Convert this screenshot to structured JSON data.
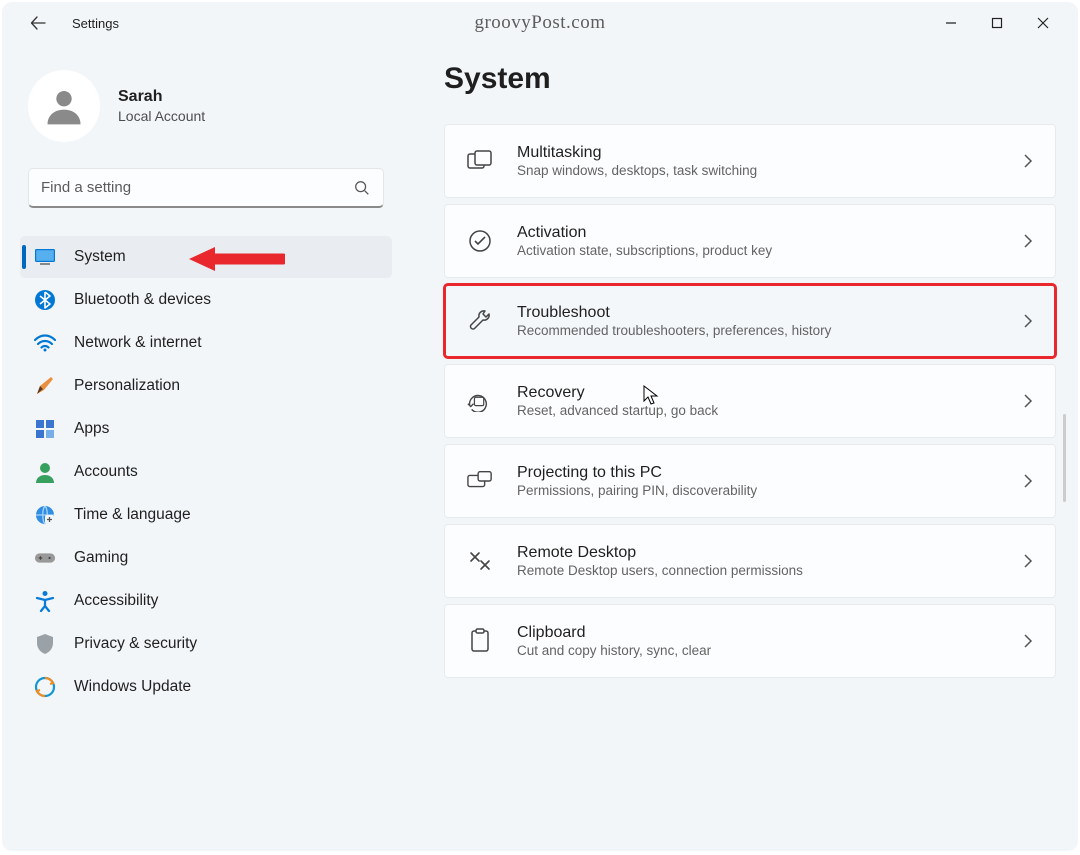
{
  "titlebar": {
    "title": "Settings",
    "watermark": "groovyPost.com"
  },
  "profile": {
    "name": "Sarah",
    "account_type": "Local Account"
  },
  "search": {
    "placeholder": "Find a setting"
  },
  "sidebar": {
    "items": [
      {
        "label": "System",
        "icon": "system",
        "active": true
      },
      {
        "label": "Bluetooth & devices",
        "icon": "bluetooth"
      },
      {
        "label": "Network & internet",
        "icon": "wifi"
      },
      {
        "label": "Personalization",
        "icon": "brush"
      },
      {
        "label": "Apps",
        "icon": "apps"
      },
      {
        "label": "Accounts",
        "icon": "person"
      },
      {
        "label": "Time & language",
        "icon": "globe"
      },
      {
        "label": "Gaming",
        "icon": "gamepad"
      },
      {
        "label": "Accessibility",
        "icon": "accessibility"
      },
      {
        "label": "Privacy & security",
        "icon": "shield"
      },
      {
        "label": "Windows Update",
        "icon": "update"
      }
    ]
  },
  "page": {
    "title": "System",
    "cards": [
      {
        "title": "Multitasking",
        "sub": "Snap windows, desktops, task switching",
        "icon": "multitask"
      },
      {
        "title": "Activation",
        "sub": "Activation state, subscriptions, product key",
        "icon": "check-circle"
      },
      {
        "title": "Troubleshoot",
        "sub": "Recommended troubleshooters, preferences, history",
        "icon": "wrench",
        "highlight": true
      },
      {
        "title": "Recovery",
        "sub": "Reset, advanced startup, go back",
        "icon": "recovery"
      },
      {
        "title": "Projecting to this PC",
        "sub": "Permissions, pairing PIN, discoverability",
        "icon": "project"
      },
      {
        "title": "Remote Desktop",
        "sub": "Remote Desktop users, connection permissions",
        "icon": "remote"
      },
      {
        "title": "Clipboard",
        "sub": "Cut and copy history, sync, clear",
        "icon": "clipboard"
      }
    ]
  },
  "annotation": {
    "arrow_color": "#e8282d"
  }
}
